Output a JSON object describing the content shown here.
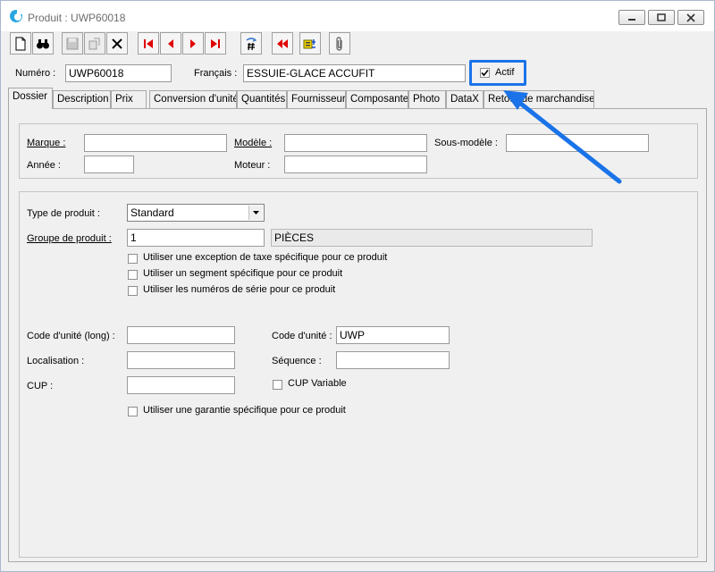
{
  "window": {
    "title": "Produit : UWP60018",
    "icons": {
      "app": "app-logo-icon",
      "minimize": "minimize-icon",
      "maximize": "maximize-icon",
      "close": "close-icon"
    }
  },
  "toolbar": {
    "buttons": [
      "new-document",
      "find-binoculars",
      "save",
      "copy",
      "delete",
      "first-record",
      "previous-record",
      "next-record",
      "last-record",
      "numbering",
      "rewind",
      "filter-list",
      "attachment"
    ]
  },
  "header": {
    "numero_label": "Numéro :",
    "numero_value": "UWP60018",
    "francais_label": "Français :",
    "francais_value": "ESSUIE-GLACE ACCUFIT",
    "actif_label": "Actif",
    "actif_checked": true
  },
  "tabs": [
    {
      "label": "Dossier",
      "active": true
    },
    {
      "label": "Description"
    },
    {
      "label": "Prix"
    },
    {
      "label": "Conversion d'unité"
    },
    {
      "label": "Quantités"
    },
    {
      "label": "Fournisseur"
    },
    {
      "label": "Composante"
    },
    {
      "label": "Photo"
    },
    {
      "label": "DataX"
    },
    {
      "label": "Retour de marchandise"
    }
  ],
  "vehicle": {
    "marque_label": "Marque :",
    "marque_value": "",
    "modele_label": "Modèle :",
    "modele_value": "",
    "sous_modele_label": "Sous-modèle :",
    "sous_modele_value": "",
    "annee_label": "Année :",
    "annee_value": "",
    "moteur_label": "Moteur :",
    "moteur_value": ""
  },
  "product": {
    "type_label": "Type de produit :",
    "type_value": "Standard",
    "groupe_label": "Groupe de produit :",
    "groupe_code": "1",
    "groupe_name": "PIÈCES",
    "checkbox_taxe": "Utiliser une exception de taxe spécifique pour ce produit",
    "checkbox_segment": "Utiliser un segment spécifique pour ce produit",
    "checkbox_serie": "Utiliser les numéros de série pour ce produit",
    "code_long_label": "Code d'unité (long) :",
    "code_long_value": "",
    "code_unite_label": "Code d'unité :",
    "code_unite_value": "UWP",
    "localisation_label": "Localisation :",
    "localisation_value": "",
    "sequence_label": "Séquence :",
    "sequence_value": "",
    "cup_label": "CUP :",
    "cup_value": "",
    "cup_variable_label": "CUP Variable",
    "checkbox_garantie": "Utiliser une garantie spécifique pour ce produit"
  },
  "annotation": {
    "color": "#1a73e8"
  }
}
